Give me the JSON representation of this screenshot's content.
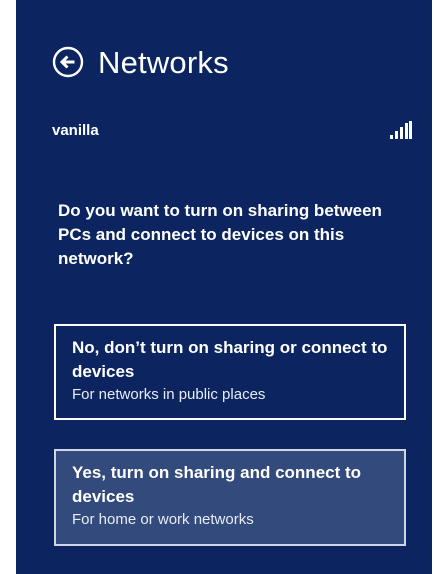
{
  "header": {
    "title": "Networks",
    "back_icon": "back-arrow-circle-icon"
  },
  "network": {
    "name": "vanilla",
    "signal_icon": "wifi-signal-bars-icon",
    "signal_level": 1.0
  },
  "prompt": {
    "question": "Do you want to turn on sharing between PCs and connect to devices on this network?"
  },
  "options": [
    {
      "title": "No, don’t turn on sharing or connect to devices",
      "subtitle": "For networks in public places"
    },
    {
      "title": "Yes, turn on sharing and connect to devices",
      "subtitle": "For home or work networks"
    }
  ],
  "colors": {
    "panel_background": "#0c2561",
    "selected_option_background": "#334a7d",
    "text": "#ffffff"
  }
}
